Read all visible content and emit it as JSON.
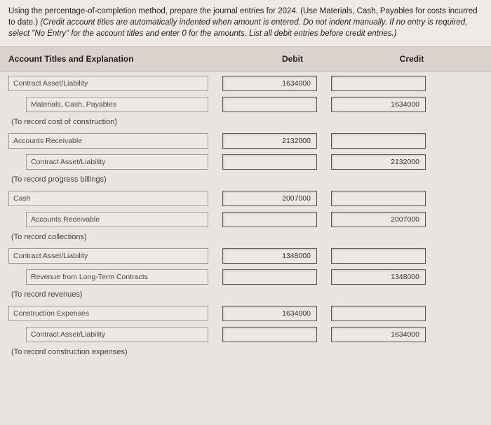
{
  "instructions": {
    "line1": "Using the percentage-of-completion method, prepare the journal entries for 2024. (Use Materials, Cash, Payables for costs incurred to date.) ",
    "italic": "(Credit account titles are automatically indented when amount is entered. Do not indent manually. If no entry is required, select \"No Entry\" for the account titles and enter 0 for the amounts. List all debit entries before credit entries.)"
  },
  "headers": {
    "account": "Account Titles and Explanation",
    "debit": "Debit",
    "credit": "Credit"
  },
  "entries": [
    {
      "debit_account": "Contract Asset/Liability",
      "debit_amount": "1634000",
      "credit_account": "Materials, Cash, Payables",
      "credit_amount": "1634000",
      "caption": "(To record cost of construction)"
    },
    {
      "debit_account": "Accounts Receivable",
      "debit_amount": "2132000",
      "credit_account": "Contract Asset/Liability",
      "credit_amount": "2132000",
      "caption": "(To record progress billings)"
    },
    {
      "debit_account": "Cash",
      "debit_amount": "2007000",
      "credit_account": "Accounts Receivable",
      "credit_amount": "2007000",
      "caption": "(To record collections)"
    },
    {
      "debit_account": "Contract Asset/Liability",
      "debit_amount": "1348000",
      "credit_account": "Revenue from Long-Term Contracts",
      "credit_amount": "1348000",
      "caption": "(To record revenues)"
    },
    {
      "debit_account": "Construction Expenses",
      "debit_amount": "1634000",
      "credit_account": "Contract Asset/Liability",
      "credit_amount": "1634000",
      "caption": "(To record construction expenses)"
    }
  ]
}
